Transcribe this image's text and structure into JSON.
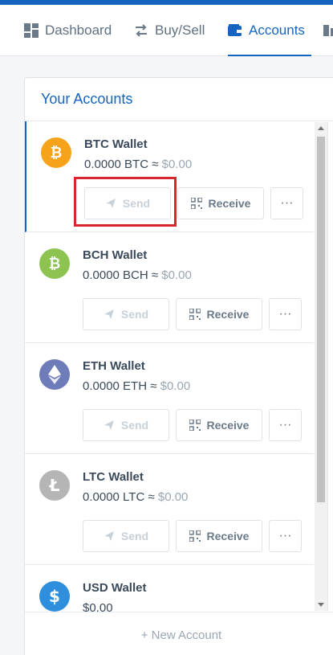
{
  "nav": {
    "dashboard": "Dashboard",
    "buysell": "Buy/Sell",
    "accounts": "Accounts"
  },
  "panel": {
    "title": "Your Accounts",
    "new_account": "+ New Account"
  },
  "wallets": [
    {
      "name": "BTC Wallet",
      "balance": "0.0000 BTC",
      "approx": " ≈ ",
      "fiat": "$0.00",
      "icon": "bitcoin-icon",
      "color": "#f7a21b"
    },
    {
      "name": "BCH Wallet",
      "balance": "0.0000 BCH",
      "approx": " ≈ ",
      "fiat": "$0.00",
      "icon": "bitcoin-cash-icon",
      "color": "#8dc351"
    },
    {
      "name": "ETH Wallet",
      "balance": "0.0000 ETH",
      "approx": " ≈ ",
      "fiat": "$0.00",
      "icon": "ethereum-icon",
      "color": "#6f7cba"
    },
    {
      "name": "LTC Wallet",
      "balance": "0.0000 LTC",
      "approx": " ≈ ",
      "fiat": "$0.00",
      "icon": "litecoin-icon",
      "color": "#b5b5b5"
    },
    {
      "name": "USD Wallet",
      "balance": "$0.00",
      "approx": "",
      "fiat": "",
      "icon": "dollar-icon",
      "color": "#2f8fdd"
    }
  ],
  "buttons": {
    "send": "Send",
    "receive": "Receive",
    "more": "···"
  },
  "colors": {
    "accent": "#1565c0",
    "highlight": "#d9262c"
  }
}
